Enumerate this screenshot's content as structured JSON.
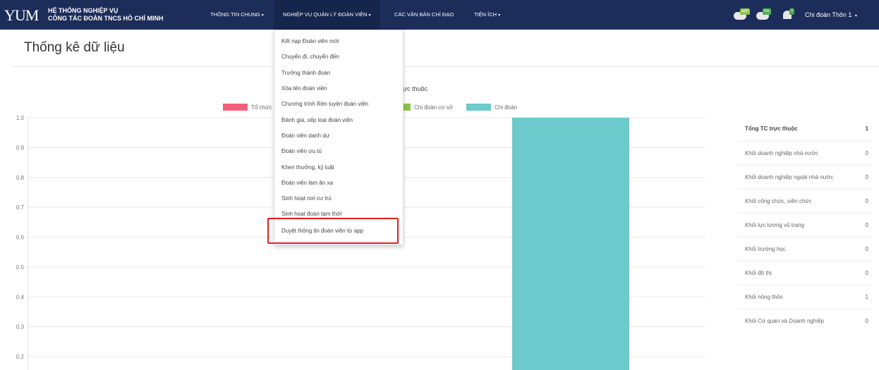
{
  "header": {
    "logo": "YUM",
    "brand_line1": "HỆ THỐNG NGHIỆP VỤ",
    "brand_line2": "CÔNG TÁC ĐOÀN TNCS HỒ CHÍ MINH",
    "nav": [
      {
        "label": "THÔNG TIN CHUNG"
      },
      {
        "label": "NGHIỆP VỤ QUẢN LÝ ĐOÀN VIÊN"
      },
      {
        "label": "CÁC VĂN BẢN CHỈ ĐẠO"
      },
      {
        "label": "TIỆN ÍCH"
      }
    ],
    "icons": [
      {
        "name": "android-download-icon",
        "badge": "apk",
        "color": "#8bc34a"
      },
      {
        "name": "ios-download-icon",
        "badge": "ios",
        "color": "#4caf50"
      },
      {
        "name": "notification-bell-icon",
        "badge": "0",
        "color": "#43a047"
      }
    ],
    "user": "Chi đoàn Thôn 1"
  },
  "page": {
    "title": "Thống kê dữ liệu"
  },
  "dropdown": {
    "items": [
      "Kết nạp Đoàn viên mới",
      "Chuyển đi, chuyển đến",
      "Trưởng thành đoàn",
      "Xóa tên đoàn viên",
      "Chương trình Rèn luyện đoàn viên",
      "Đánh giá, xếp loại đoàn viên",
      "Đoàn viên danh dự",
      "Đoàn viên ưu tú",
      "Khen thưởng, kỷ luật",
      "Đoàn viên làm ăn xa",
      "Sinh hoạt nơi cư trú",
      "Sinh hoạt đoàn tạm thời",
      "Duyệt thông tin đoàn viên từ app"
    ]
  },
  "chart_data": {
    "type": "bar",
    "title_visible": "ực thuộc",
    "legend": [
      {
        "name": "Tổ chức",
        "visible_text": "Tổ chức",
        "color": "#f0607a"
      },
      {
        "name": "Chi đoàn cơ sở",
        "color": "#8bc34a"
      },
      {
        "name": "Chi đoàn",
        "color": "#6cc9cc"
      }
    ],
    "ylim": [
      0.2,
      1.0
    ],
    "yticks": [
      "1.0",
      "0.9",
      "0.8",
      "0.7",
      "0.6",
      "0.5",
      "0.4",
      "0.3",
      "0.2"
    ],
    "series": [
      {
        "name": "Chi đoàn",
        "values": [
          1
        ]
      }
    ],
    "grid": true
  },
  "stats": {
    "rows": [
      {
        "label": "Tổng TC trực thuộc",
        "value": "1"
      },
      {
        "label": "Khối doanh nghiệp nhà nước",
        "value": "0"
      },
      {
        "label": "Khối doanh nghiệp ngoài nhà nước",
        "value": "0"
      },
      {
        "label": "Khối công chức, viên chức",
        "value": "0"
      },
      {
        "label": "Khối lực lượng vũ trang",
        "value": "0"
      },
      {
        "label": "Khối trường học",
        "value": "0"
      },
      {
        "label": "Khối đô thị",
        "value": "0"
      },
      {
        "label": "Khối nông thôn",
        "value": "1"
      },
      {
        "label": "Khối Cơ quan và Doanh nghiệp",
        "value": "0"
      }
    ]
  }
}
